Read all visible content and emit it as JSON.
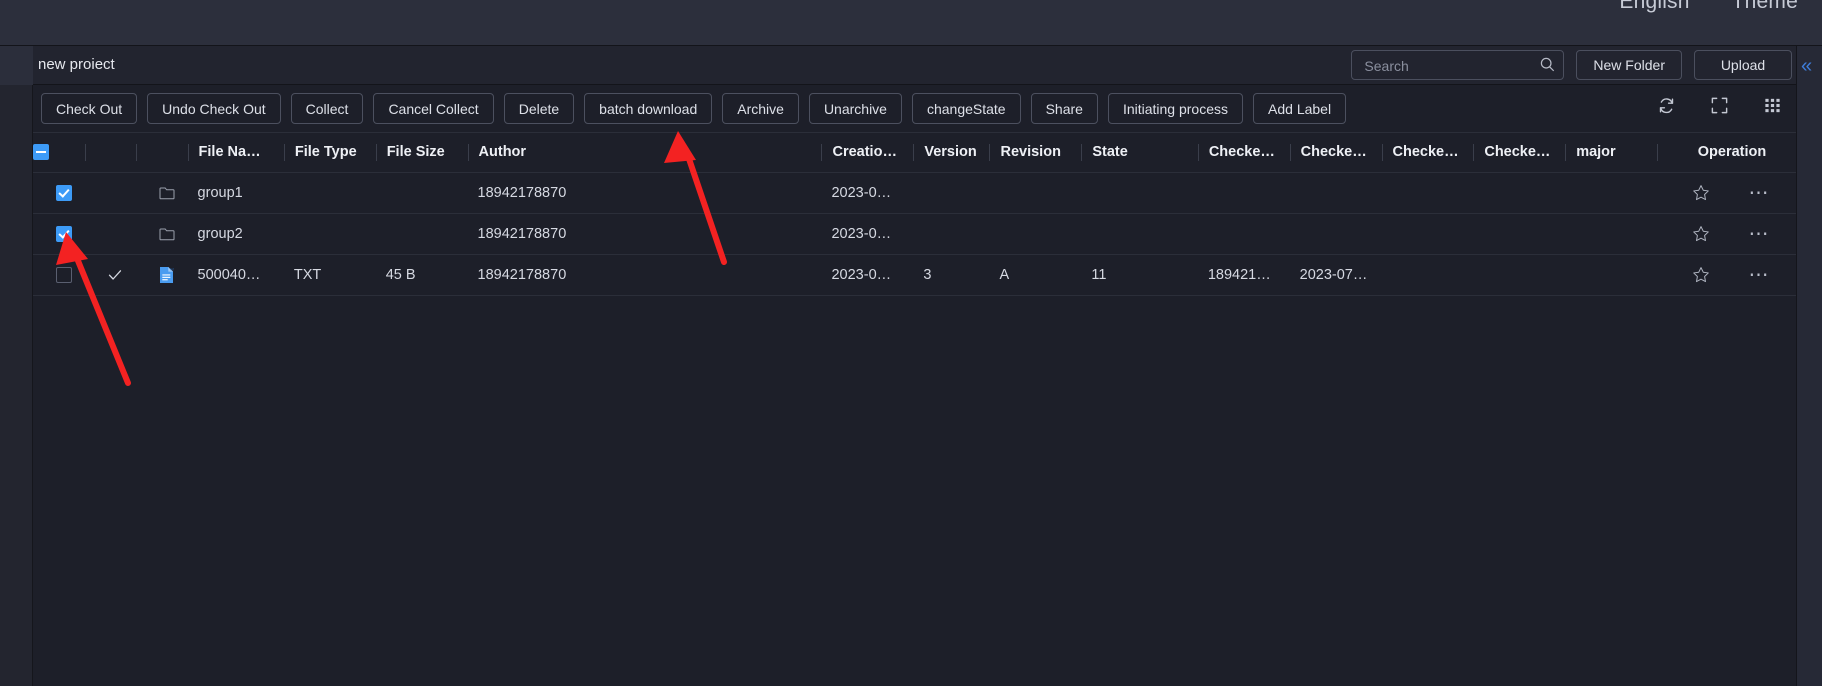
{
  "topbar": {
    "links": [
      {
        "label": "English",
        "name": "language-selector"
      },
      {
        "label": "Theme",
        "name": "theme-selector"
      }
    ]
  },
  "panel": {
    "title": "new proiect",
    "search": {
      "placeholder": "Search",
      "value": ""
    },
    "new_folder_label": "New Folder",
    "upload_label": "Upload"
  },
  "toolbar": {
    "buttons": [
      {
        "label": "Check Out",
        "name": "check-out-button"
      },
      {
        "label": "Undo Check Out",
        "name": "undo-check-out-button"
      },
      {
        "label": "Collect",
        "name": "collect-button"
      },
      {
        "label": "Cancel Collect",
        "name": "cancel-collect-button"
      },
      {
        "label": "Delete",
        "name": "delete-button"
      },
      {
        "label": "batch download",
        "name": "batch-download-button"
      },
      {
        "label": "Archive",
        "name": "archive-button"
      },
      {
        "label": "Unarchive",
        "name": "unarchive-button"
      },
      {
        "label": "changeState",
        "name": "change-state-button"
      },
      {
        "label": "Share",
        "name": "share-button"
      },
      {
        "label": "Initiating process",
        "name": "initiating-process-button"
      },
      {
        "label": "Add Label",
        "name": "add-label-button"
      }
    ],
    "icons": [
      {
        "name": "refresh-icon"
      },
      {
        "name": "fullscreen-icon"
      },
      {
        "name": "column-settings-icon"
      }
    ]
  },
  "table": {
    "select_all_state": "indeterminate",
    "columns": [
      "File Na…",
      "File Type",
      "File Size",
      "Author",
      "Creatio…",
      "Version",
      "Revision",
      "State",
      "Checke…",
      "Checke…",
      "Checke…",
      "Checke…",
      "major",
      "Operation"
    ],
    "rows": [
      {
        "checked": true,
        "icon": "folder-icon",
        "status_tick": false,
        "file_name": "group1",
        "file_type": "",
        "file_size": "",
        "author": "18942178870",
        "creation": "2023-0…",
        "version": "",
        "revision": "",
        "state": "",
        "checked_1": "",
        "checked_2": "",
        "checked_3": "",
        "checked_4": "",
        "major": ""
      },
      {
        "checked": true,
        "icon": "folder-icon",
        "status_tick": false,
        "file_name": "group2",
        "file_type": "",
        "file_size": "",
        "author": "18942178870",
        "creation": "2023-0…",
        "version": "",
        "revision": "",
        "state": "",
        "checked_1": "",
        "checked_2": "",
        "checked_3": "",
        "checked_4": "",
        "major": ""
      },
      {
        "checked": false,
        "icon": "txt-file-icon",
        "status_tick": true,
        "file_name": "500040…",
        "file_type": "TXT",
        "file_size": "45 B",
        "author": "18942178870",
        "creation": "2023-0…",
        "version": "3",
        "revision": "A",
        "state": "11",
        "checked_1": "189421…",
        "checked_2": "2023-07…",
        "checked_3": "",
        "checked_4": "",
        "major": ""
      }
    ]
  },
  "right_rail": {
    "collapse_label": "«"
  },
  "colors": {
    "accent": "#3d9bf7",
    "panel_bg": "#1d1f29",
    "header_bg": "#22242f",
    "topbar_bg": "#2c2f3c",
    "border": "#4b4f5e",
    "text": "#dde0e8",
    "annotation": "#f32222"
  }
}
